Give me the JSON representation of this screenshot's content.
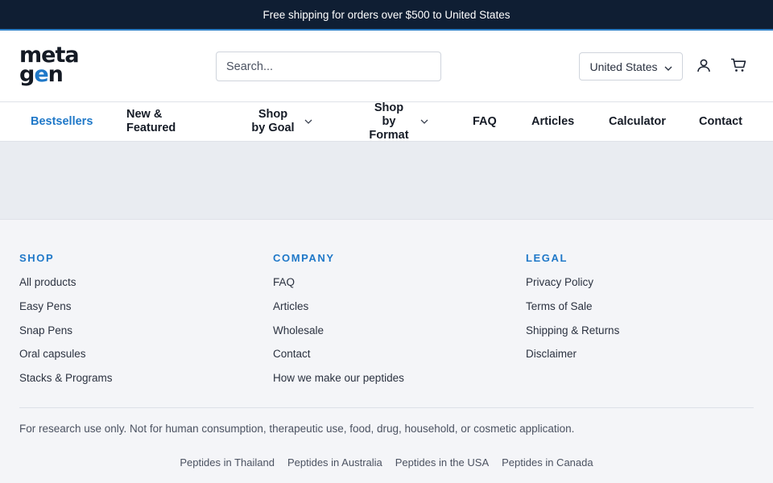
{
  "announcement": "Free shipping for orders over $500 to United States",
  "header": {
    "logo_line1": "meta",
    "logo_line2_a": "g",
    "logo_line2_b": "e",
    "logo_line2_c": "n",
    "search_placeholder": "Search...",
    "country": "United States",
    "icons": [
      "chevron-down-icon",
      "user-icon",
      "cart-icon"
    ]
  },
  "nav": {
    "items": [
      {
        "label": "Bestsellers",
        "active": true
      },
      {
        "label": "New & Featured"
      },
      {
        "label": "Shop by Goal",
        "dropdown": true
      },
      {
        "label": "Shop by Format",
        "dropdown": true
      },
      {
        "label": "FAQ"
      },
      {
        "label": "Articles"
      },
      {
        "label": "Calculator"
      },
      {
        "label": "Contact"
      }
    ]
  },
  "footer": {
    "shop": {
      "title": "SHOP",
      "links": [
        "All products",
        "Easy Pens",
        "Snap Pens",
        "Oral capsules",
        "Stacks & Programs"
      ]
    },
    "company": {
      "title": "COMPANY",
      "links": [
        "FAQ",
        "Articles",
        "Wholesale",
        "Contact",
        "How we make our peptides"
      ]
    },
    "legal": {
      "title": "LEGAL",
      "links": [
        "Privacy Policy",
        "Terms of Sale",
        "Shipping & Returns",
        "Disclaimer"
      ]
    },
    "disclaimer": "For research use only. Not for human consumption, therapeutic use, food, drug, household, or cosmetic application.",
    "regions": [
      "Peptides in Thailand",
      "Peptides in Australia",
      "Peptides in the USA",
      "Peptides in Canada"
    ]
  },
  "colors": {
    "accent": "#1f78c8",
    "announcement_bg": "#0f1e33"
  }
}
